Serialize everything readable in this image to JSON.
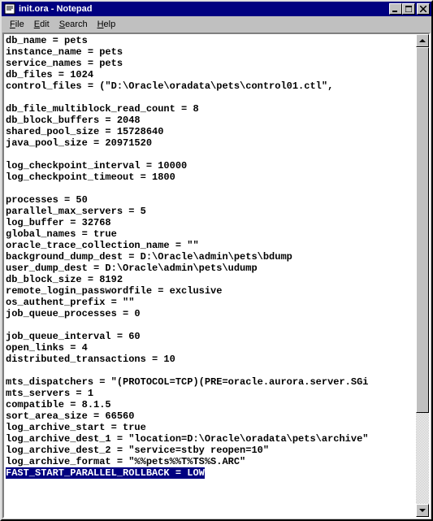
{
  "window": {
    "title": "init.ora - Notepad",
    "buttons": {
      "min": "_",
      "max": "▢",
      "close": "✕"
    }
  },
  "menu": {
    "file": "File",
    "edit": "Edit",
    "search": "Search",
    "help": "Help"
  },
  "editor": {
    "lines": [
      "db_name = pets",
      "instance_name = pets",
      "service_names = pets",
      "db_files = 1024",
      "control_files = (\"D:\\Oracle\\oradata\\pets\\control01.ctl\",",
      "db_file_multiblock_read_count = 8",
      "db_block_buffers = 2048",
      "shared_pool_size = 15728640",
      "java_pool_size = 20971520",
      "log_checkpoint_interval = 10000",
      "log_checkpoint_timeout = 1800",
      "processes = 50",
      "parallel_max_servers = 5",
      "log_buffer = 32768",
      "global_names = true",
      "oracle_trace_collection_name = \"\"",
      "background_dump_dest = D:\\Oracle\\admin\\pets\\bdump",
      "user_dump_dest = D:\\Oracle\\admin\\pets\\udump",
      "db_block_size = 8192",
      "remote_login_passwordfile = exclusive",
      "os_authent_prefix = \"\"",
      "job_queue_processes = 0",
      "job_queue_interval = 60",
      "open_links = 4",
      "distributed_transactions = 10",
      "mts_dispatchers = \"(PROTOCOL=TCP)(PRE=oracle.aurora.server.SGi",
      "mts_servers = 1",
      "compatible = 8.1.5",
      "sort_area_size = 66560",
      "log_archive_start = true",
      "log_archive_dest_1 = \"location=D:\\Oracle\\oradata\\pets\\archive\"",
      "log_archive_dest_2 = \"service=stby reopen=10\"",
      "log_archive_format = \"%%pets%%T%TS%S.ARC\""
    ],
    "highlighted_line": "FAST_START_PARALLEL_ROLLBACK = LOW",
    "blank_after": [
      4,
      8,
      10,
      21,
      24
    ]
  },
  "scrollbar": {
    "up": "▲",
    "down": "▼"
  }
}
